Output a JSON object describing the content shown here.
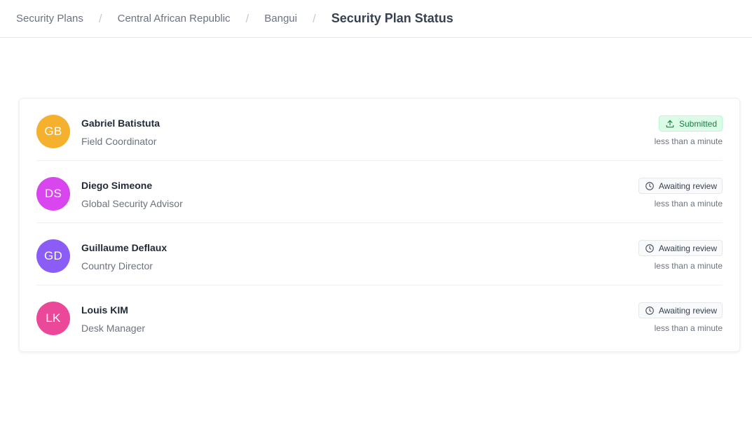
{
  "breadcrumb": {
    "items": [
      "Security Plans",
      "Central African Republic",
      "Bangui"
    ],
    "current": "Security Plan Status"
  },
  "colors": {
    "submitted_bg": "#dcfce7",
    "submitted_text": "#15803d"
  },
  "people": [
    {
      "initials": "GB",
      "avatar_color": "#f5b02e",
      "name": "Gabriel Batistuta",
      "role": "Field Coordinator",
      "status": "Submitted",
      "status_icon": "upload-icon",
      "time": "less than a minute"
    },
    {
      "initials": "DS",
      "avatar_color": "#d946ef",
      "name": "Diego Simeone",
      "role": "Global Security Advisor",
      "status": "Awaiting review",
      "status_icon": "clock-icon",
      "time": "less than a minute"
    },
    {
      "initials": "GD",
      "avatar_color": "#8b5cf6",
      "name": "Guillaume Deflaux",
      "role": "Country Director",
      "status": "Awaiting review",
      "status_icon": "clock-icon",
      "time": "less than a minute"
    },
    {
      "initials": "LK",
      "avatar_color": "#ec4899",
      "name": "Louis KIM",
      "role": "Desk Manager",
      "status": "Awaiting review",
      "status_icon": "clock-icon",
      "time": "less than a minute"
    }
  ]
}
